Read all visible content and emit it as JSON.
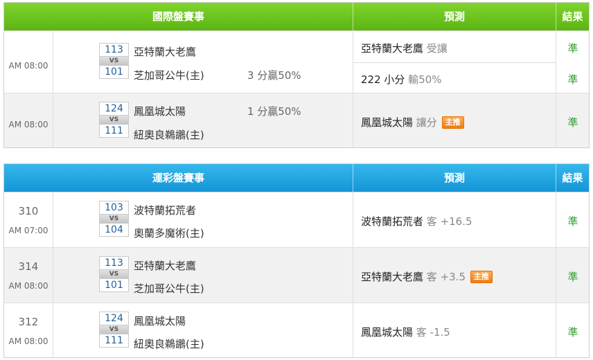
{
  "colors": {
    "intl_header": "#6cc41d",
    "lottery_header": "#22a7e2",
    "result": "#2e9b2e",
    "badge": "#f7921e",
    "team_id": "#1f5f9a"
  },
  "intl": {
    "headers": {
      "title": "國際盤賽事",
      "predict": "預測",
      "result": "結果"
    },
    "rows": [
      {
        "time": "AM 08:00",
        "away_id": "113",
        "away": "亞特蘭大老鷹",
        "vs": "VS",
        "home_id": "101",
        "home": "芝加哥公牛(主)",
        "odds": "3 分贏50%",
        "pred1_team": "亞特蘭大老鷹",
        "pred1_sub": "受讓",
        "res1": "準",
        "pred2_team": "222 小分",
        "pred2_sub": "輸50%",
        "res2": "準"
      },
      {
        "time": "AM 08:00",
        "away_id": "124",
        "away": "鳳凰城太陽",
        "vs": "VS",
        "home_id": "111",
        "home": "紐奧良鵜鶘(主)",
        "odds": "1 分贏50%",
        "pred_team": "鳳凰城太陽",
        "pred_sub": "讓分",
        "badge": "主推",
        "res": "準"
      }
    ]
  },
  "lottery": {
    "headers": {
      "title": "運彩盤賽事",
      "predict": "預測",
      "result": "結果"
    },
    "rows": [
      {
        "num": "310",
        "time": "AM 07:00",
        "away_id": "103",
        "away": "波特蘭拓荒者",
        "vs": "VS",
        "home_id": "104",
        "home": "奧蘭多魔術(主)",
        "pred_team": "波特蘭拓荒者",
        "pred_sub": "客 +16.5",
        "res": "準"
      },
      {
        "num": "314",
        "time": "AM 08:00",
        "away_id": "113",
        "away": "亞特蘭大老鷹",
        "vs": "VS",
        "home_id": "101",
        "home": "芝加哥公牛(主)",
        "pred_team": "亞特蘭大老鷹",
        "pred_sub": "客 +3.5",
        "badge": "主推",
        "res": "準"
      },
      {
        "num": "312",
        "time": "AM 08:00",
        "away_id": "124",
        "away": "鳳凰城太陽",
        "vs": "VS",
        "home_id": "111",
        "home": "紐奧良鵜鶘(主)",
        "pred_team": "鳳凰城太陽",
        "pred_sub": "客 -1.5",
        "res": "準"
      }
    ]
  }
}
